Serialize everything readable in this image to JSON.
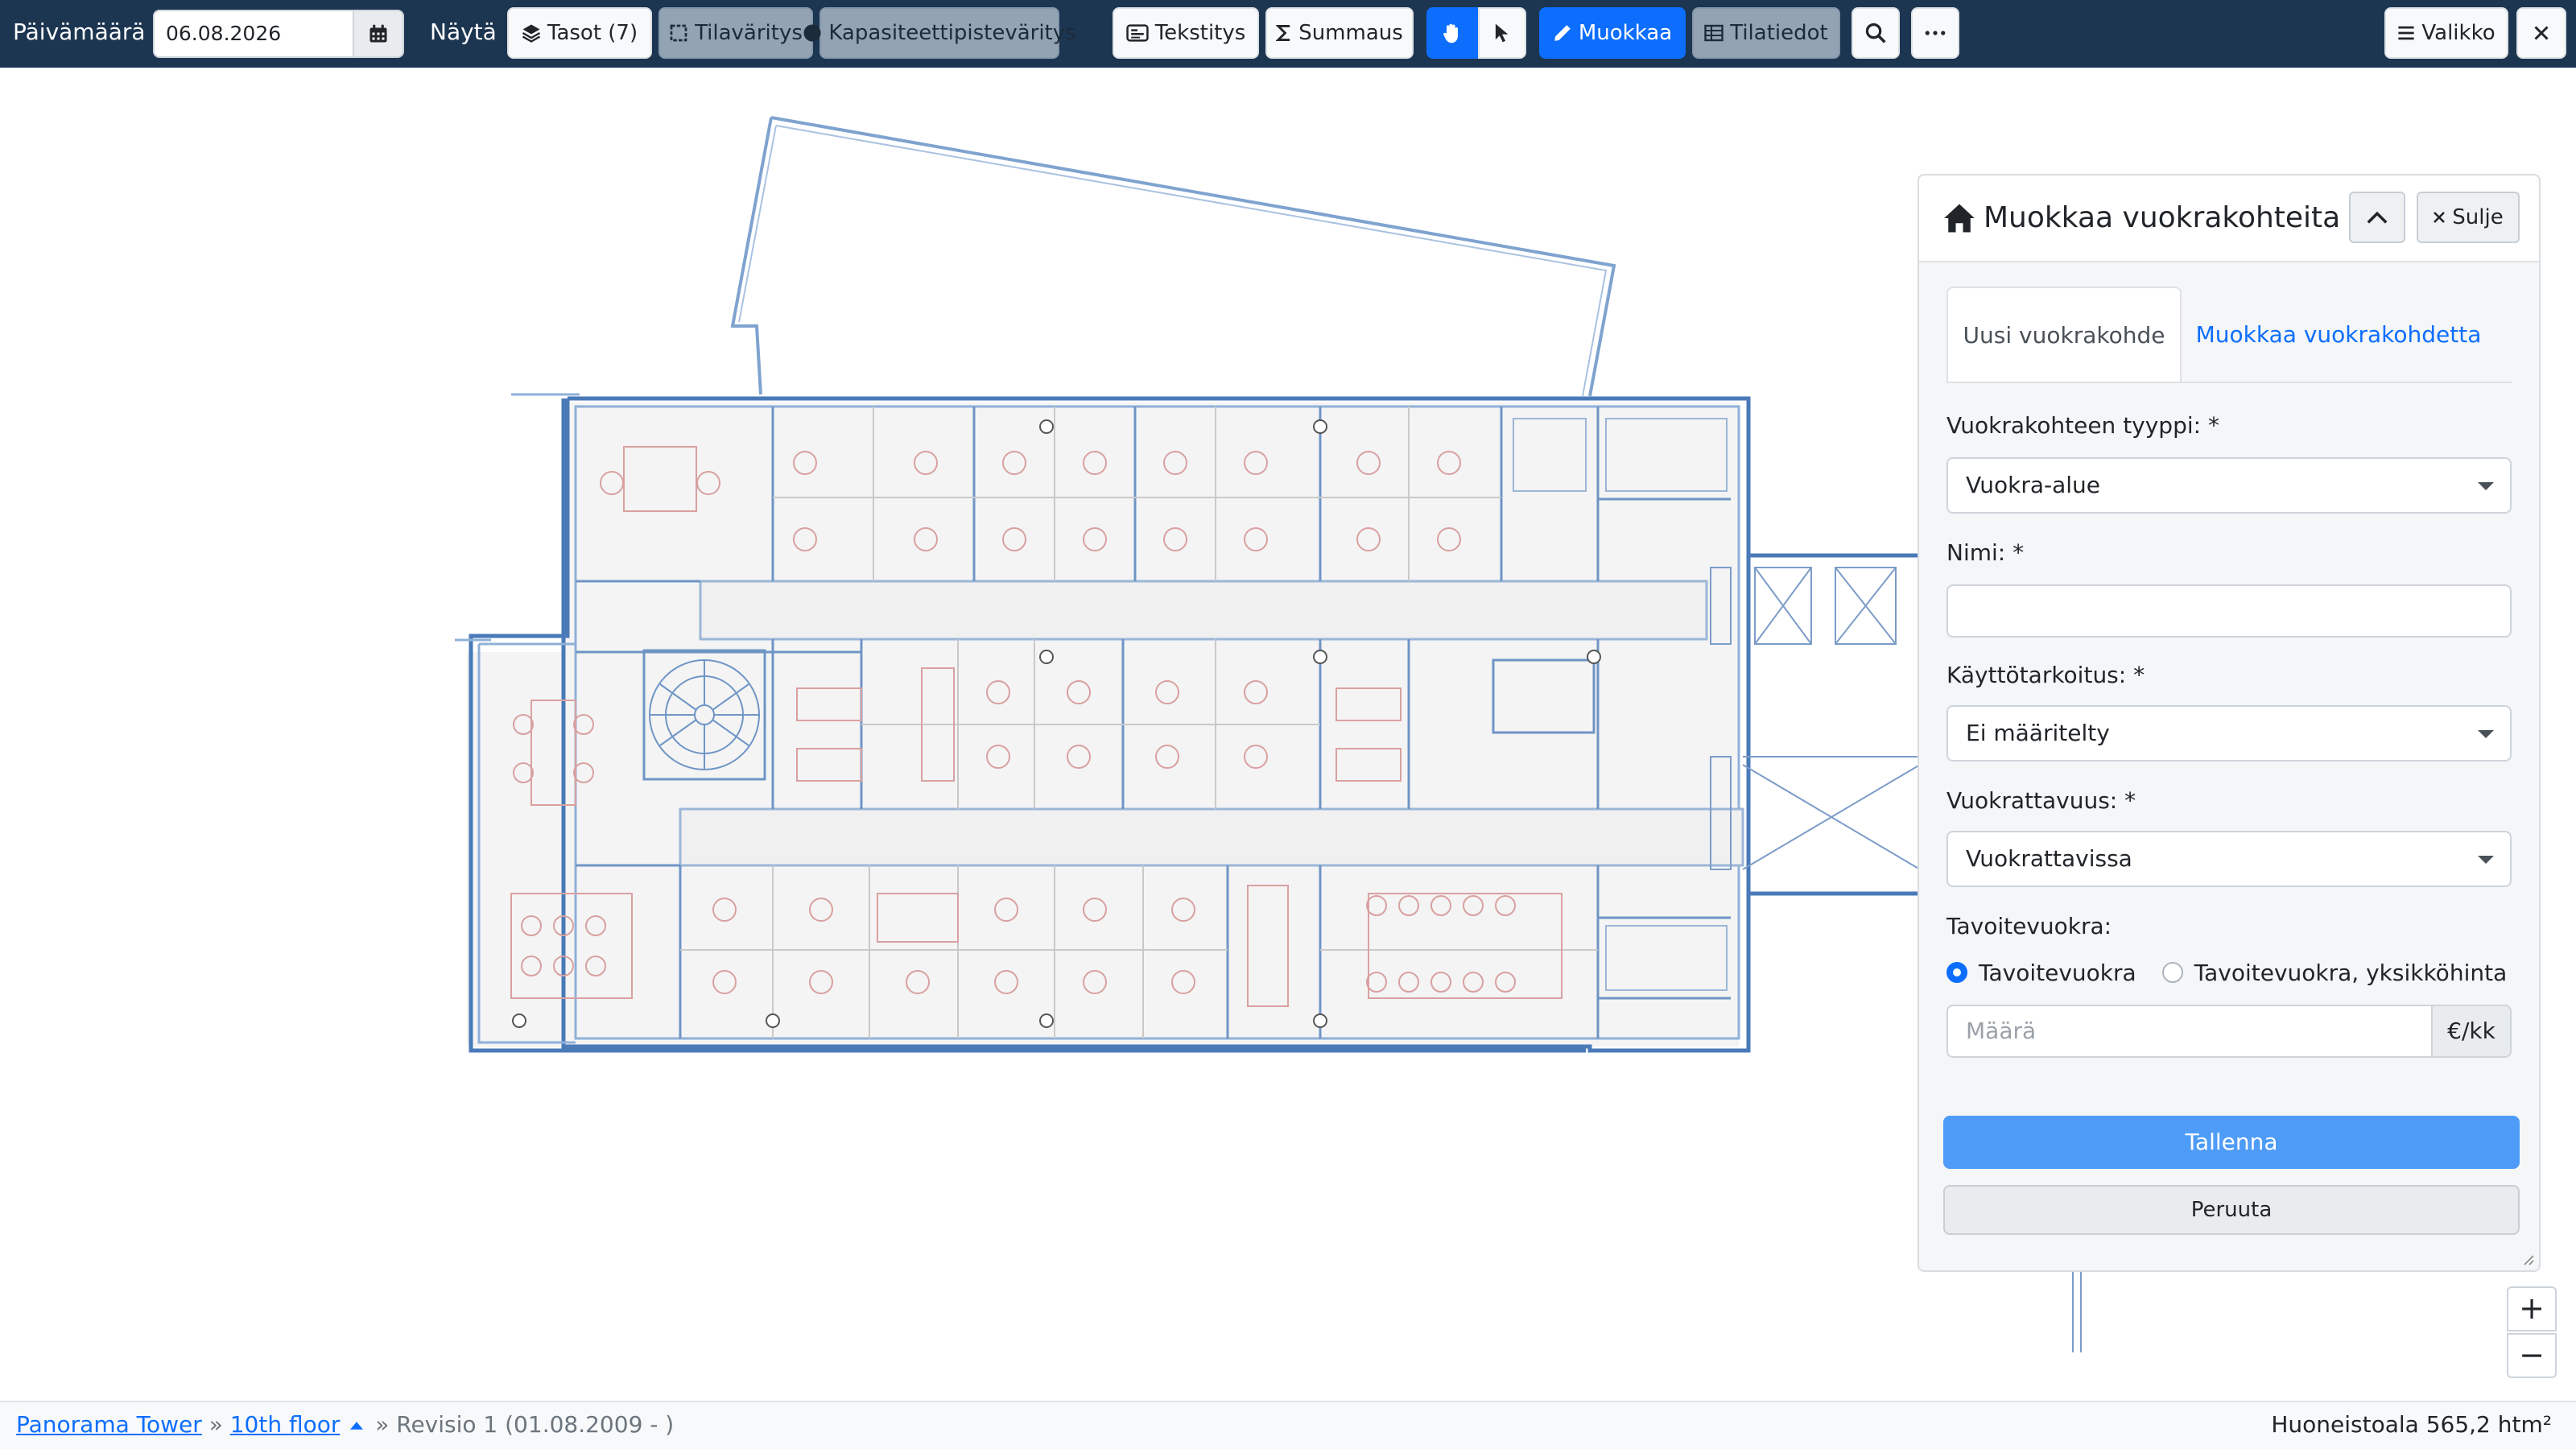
{
  "toolbar": {
    "date_label": "Päivämäärä",
    "date_value": "06.08.2026",
    "show_label": "Näytä",
    "layers_label": "Tasot (7)",
    "space_coloring_label": "Tilaväritys",
    "capacity_coloring_label": "Kapasiteettipisteväritys",
    "texts_label": "Tekstitys",
    "sum_label": "Summaus",
    "edit_label": "Muokkaa",
    "space_data_label": "Tilatiedot",
    "menu_label": "Valikko",
    "pan_icon": "hand-icon",
    "select_icon": "pointer-icon",
    "search_icon": "search-icon",
    "more_icon": "ellipsis-icon",
    "close_icon": "close-icon"
  },
  "panel": {
    "title": "Muokkaa vuokrakohteita",
    "close_label": "Sulje",
    "tabs": [
      {
        "label": "Uusi vuokrakohde",
        "active": true
      },
      {
        "label": "Muokkaa vuokrakohdetta",
        "active": false
      }
    ],
    "fields": {
      "type_label": "Vuokrakohteen tyyppi: *",
      "type_value": "Vuokra-alue",
      "name_label": "Nimi: *",
      "name_value": "",
      "purpose_label": "Käyttötarkoitus: *",
      "purpose_value": "Ei määritelty",
      "availability_label": "Vuokrattavuus: *",
      "availability_value": "Vuokrattavissa",
      "target_rent_label": "Tavoitevuokra:",
      "radio_options": [
        {
          "label": "Tavoitevuokra",
          "checked": true
        },
        {
          "label": "Tavoitevuokra, yksikköhinta",
          "checked": false
        }
      ],
      "amount_placeholder": "Määrä",
      "amount_unit": "€/kk"
    },
    "save_label": "Tallenna",
    "cancel_label": "Peruuta"
  },
  "zoom": {
    "in_label": "+",
    "out_label": "−"
  },
  "footer": {
    "breadcrumb_building": "Panorama Tower",
    "breadcrumb_separator": "»",
    "breadcrumb_floor": "10th floor",
    "revision": "» Revisio 1 (01.08.2009 - )",
    "area_text": "Huoneistoala 565,2 htm²"
  },
  "colors": {
    "toolbar_bg": "#1c3551",
    "primary": "#0d6efd",
    "save_button": "#4e9cf7",
    "plan_walls": "#4a7ab8",
    "plan_furniture": "#d9a0a0"
  }
}
